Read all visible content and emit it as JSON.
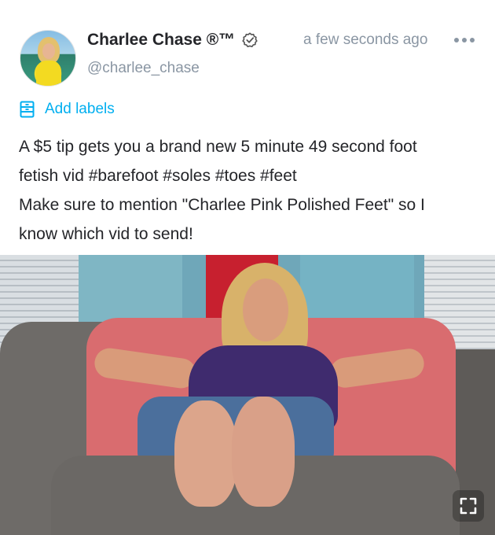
{
  "post": {
    "author": {
      "display_name": "Charlee Chase ®™",
      "handle": "@charlee_chase",
      "verified_icon": "verified-badge-icon",
      "avatar_icon": "avatar"
    },
    "timestamp": "a few seconds ago",
    "more_icon": "more-horizontal-icon",
    "labels": {
      "icon": "label-icon",
      "text": "Add labels"
    },
    "text_lines": [
      "A $5 tip gets you a brand new 5 minute 49 second foot",
      "fetish vid #barefoot #soles #toes #feet",
      "Make sure to mention \"Charlee Pink Polished Feet\" so I",
      "know which vid to send!"
    ],
    "media": {
      "expand_icon": "expand-icon"
    }
  },
  "colors": {
    "accent": "#00aff0",
    "muted": "#8a96a3",
    "text": "#242529"
  }
}
